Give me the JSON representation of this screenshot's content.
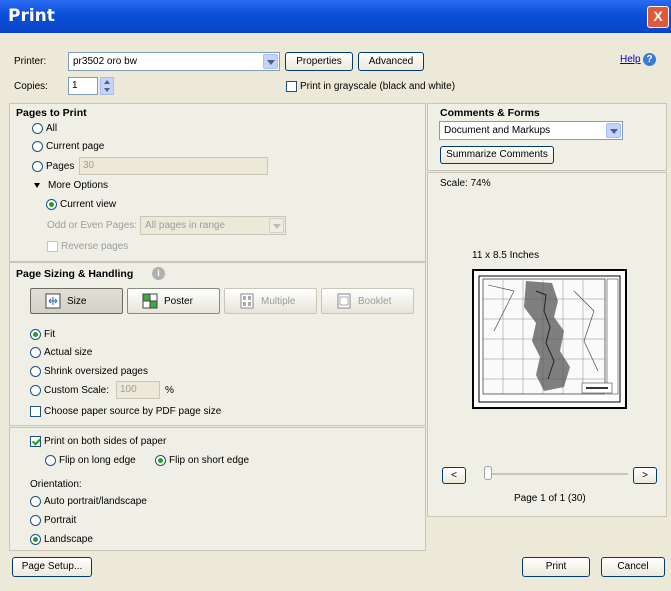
{
  "window": {
    "title": "Print",
    "close": "X"
  },
  "header": {
    "printer_label": "Printer:",
    "printer_value": "pr3502 oro bw",
    "properties_label": "Properties",
    "advanced_label": "Advanced",
    "help_label": "Help",
    "help_icon": "?",
    "copies_label": "Copies:",
    "copies_value": "1",
    "grayscale_label": "Print in grayscale (black and white)"
  },
  "pages_to_print": {
    "title": "Pages to Print",
    "all": "All",
    "current_page": "Current page",
    "pages": "Pages",
    "pages_value": "30",
    "more_options": "More Options",
    "current_view": "Current view",
    "odd_even_label": "Odd or Even Pages:",
    "odd_even_value": "All pages in range",
    "reverse_pages": "Reverse pages"
  },
  "sizing": {
    "title": "Page Sizing & Handling",
    "info_icon": "i",
    "size": "Size",
    "poster": "Poster",
    "multiple": "Multiple",
    "booklet": "Booklet",
    "fit": "Fit",
    "actual_size": "Actual size",
    "shrink": "Shrink oversized pages",
    "custom_scale": "Custom Scale:",
    "custom_scale_value": "100",
    "percent": "%",
    "paper_source": "Choose paper source by PDF page size"
  },
  "duplex": {
    "both_sides": "Print on both sides of paper",
    "long_edge": "Flip on long edge",
    "short_edge": "Flip on short edge"
  },
  "orientation": {
    "title": "Orientation:",
    "auto": "Auto portrait/landscape",
    "portrait": "Portrait",
    "landscape": "Landscape"
  },
  "comments": {
    "title": "Comments & Forms",
    "value": "Document and Markups",
    "summarize": "Summarize Comments"
  },
  "preview": {
    "scale": "Scale:  74%",
    "paper_size": "11 x 8.5 Inches",
    "prev": "<",
    "next": ">",
    "page_info": "Page 1 of 1 (30)"
  },
  "footer": {
    "page_setup": "Page Setup...",
    "print": "Print",
    "cancel": "Cancel"
  }
}
